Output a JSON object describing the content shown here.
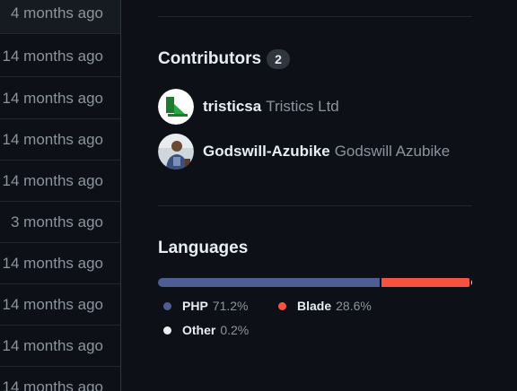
{
  "file_list": {
    "rows": [
      {
        "age": "4 months ago"
      },
      {
        "age": "14 months ago"
      },
      {
        "age": "14 months ago"
      },
      {
        "age": "14 months ago"
      },
      {
        "age": "14 months ago"
      },
      {
        "age": "3 months ago"
      },
      {
        "age": "14 months ago"
      },
      {
        "age": "14 months ago"
      },
      {
        "age": "14 months ago"
      },
      {
        "age": "14 months ago"
      }
    ]
  },
  "contributors": {
    "title": "Contributors",
    "count": "2",
    "items": [
      {
        "login": "tristicsa",
        "name": "Tristics Ltd",
        "avatar_icon": "tristics-logo-icon"
      },
      {
        "login": "Godswill-Azubike",
        "name": "Godswill Azubike",
        "avatar_icon": "user-photo-avatar"
      }
    ]
  },
  "languages": {
    "title": "Languages",
    "items": [
      {
        "name": "PHP",
        "percent": "71.2%",
        "value": 71.2,
        "color": "#4f5d95"
      },
      {
        "name": "Blade",
        "percent": "28.6%",
        "value": 28.6,
        "color": "#f7523f"
      },
      {
        "name": "Other",
        "percent": "0.2%",
        "value": 0.2,
        "color": "#ededed"
      }
    ]
  }
}
